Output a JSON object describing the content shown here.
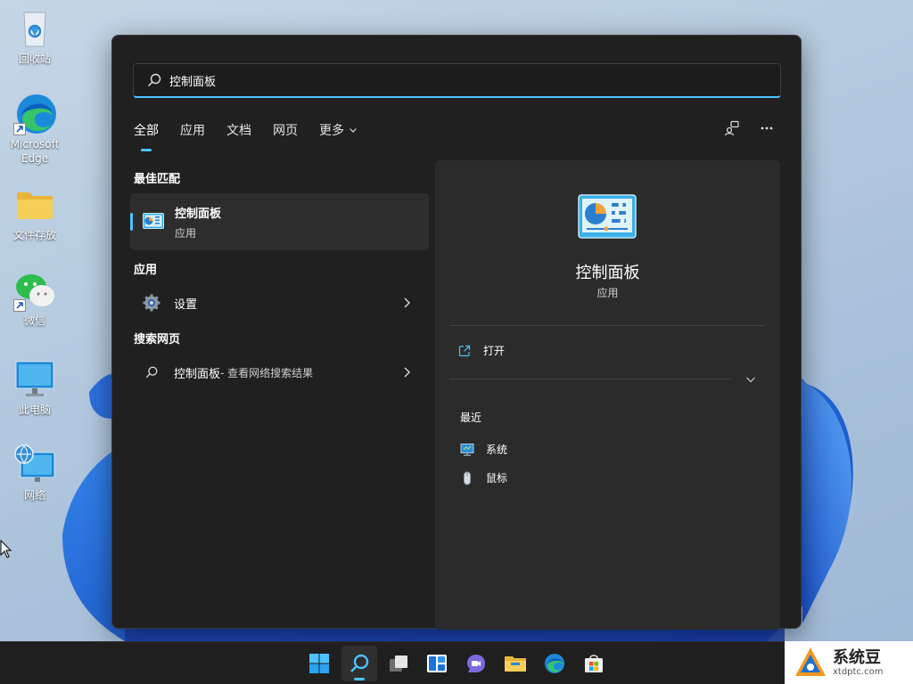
{
  "desktop": {
    "icons": [
      {
        "label": "回收站",
        "icon": "recycle-bin-icon"
      },
      {
        "label": "Microsoft Edge",
        "icon": "edge-icon"
      },
      {
        "label": "文件存放",
        "icon": "folder-icon"
      },
      {
        "label": "微信",
        "icon": "wechat-icon"
      },
      {
        "label": "此电脑",
        "icon": "computer-icon"
      },
      {
        "label": "网络",
        "icon": "network-icon"
      }
    ]
  },
  "search": {
    "query": "控制面板",
    "tabs": [
      {
        "label": "全部",
        "active": true
      },
      {
        "label": "应用",
        "active": false
      },
      {
        "label": "文档",
        "active": false
      },
      {
        "label": "网页",
        "active": false
      },
      {
        "label": "更多",
        "active": false
      }
    ]
  },
  "results": {
    "best_match_heading": "最佳匹配",
    "best_match": {
      "title": "控制面板",
      "subtitle": "应用"
    },
    "apps_heading": "应用",
    "apps": [
      {
        "label": "设置"
      }
    ],
    "web_heading": "搜索网页",
    "web": {
      "label": "控制面板",
      "suffix": " - 查看网络搜索结果"
    }
  },
  "detail": {
    "title": "控制面板",
    "subtitle": "应用",
    "open_label": "打开",
    "recent_heading": "最近",
    "recent": [
      {
        "label": "系统",
        "icon": "system-icon"
      },
      {
        "label": "鼠标",
        "icon": "mouse-icon"
      }
    ]
  },
  "taskbar": {
    "items": [
      "start-icon",
      "search-icon",
      "task-view-icon",
      "widgets-icon",
      "teams-chat-icon",
      "file-explorer-icon",
      "edge-icon",
      "store-icon"
    ]
  },
  "watermark": {
    "text": "系统豆",
    "url": "xtdptc.com"
  },
  "colors": {
    "accent": "#4cc2ff",
    "panel_bg": "#202020",
    "detail_bg": "#2b2b2b"
  }
}
